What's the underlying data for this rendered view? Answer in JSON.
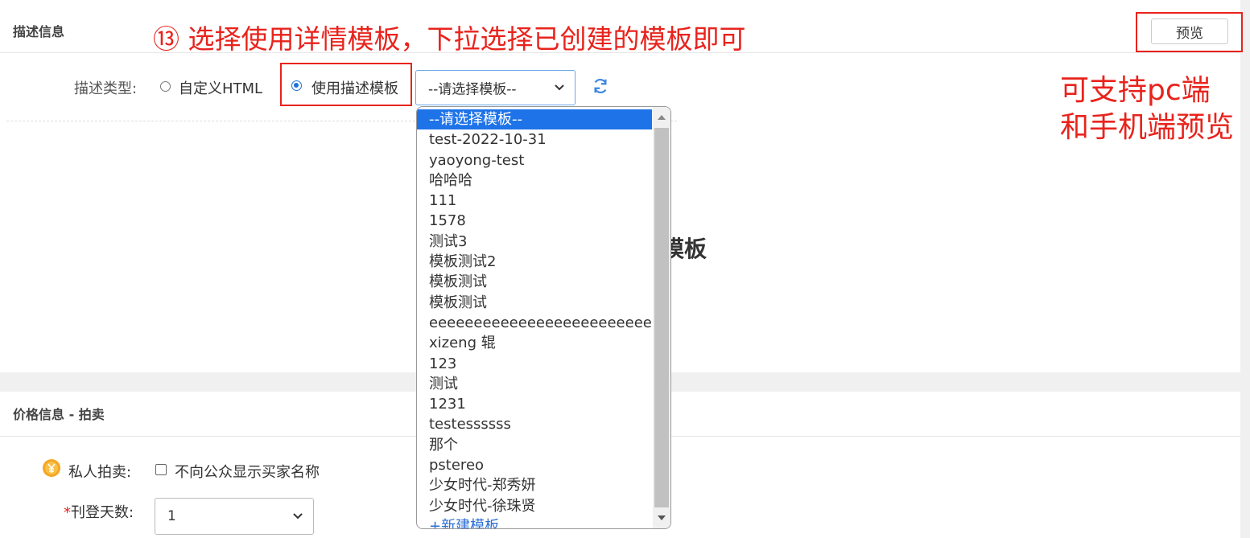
{
  "description_section": {
    "title": "描述信息",
    "type_label": "描述类型:",
    "option_custom_html": "自定义HTML",
    "option_use_template": "使用描述模板",
    "template_select_value": "--请选择模板--",
    "preview_button": "预览",
    "background_text": "模板"
  },
  "annotations": {
    "step_title": "⑬ 选择使用详情模板，下拉选择已创建的模板即可",
    "preview_note_line1": "可支持pc端",
    "preview_note_line2": "和手机端预览"
  },
  "template_dropdown": {
    "options": [
      "--请选择模板--",
      "test-2022-10-31",
      "yaoyong-test",
      "哈哈哈",
      "111",
      "1578",
      "测试3",
      "模板测试2",
      "模板测试",
      "模板测试",
      "eeeeeeeeeeeeeeeeeeeeeeeeeee",
      "xizeng 辊",
      "123",
      "测试",
      "1231",
      "testessssss",
      "那个",
      "pstereo",
      "少女时代-郑秀妍",
      "少女时代-徐珠贤",
      "+新建模板"
    ],
    "selected_index": 0
  },
  "price_section": {
    "title": "价格信息 - 拍卖",
    "private_auction_label": "私人拍卖:",
    "private_auction_checkbox": "不向公众显示买家名称",
    "required_mark": "*",
    "listing_days_label": "刊登天数:",
    "listing_days_value": "1"
  },
  "colors": {
    "annotation_red": "#e8231c",
    "accent_blue": "#1e73e8"
  }
}
